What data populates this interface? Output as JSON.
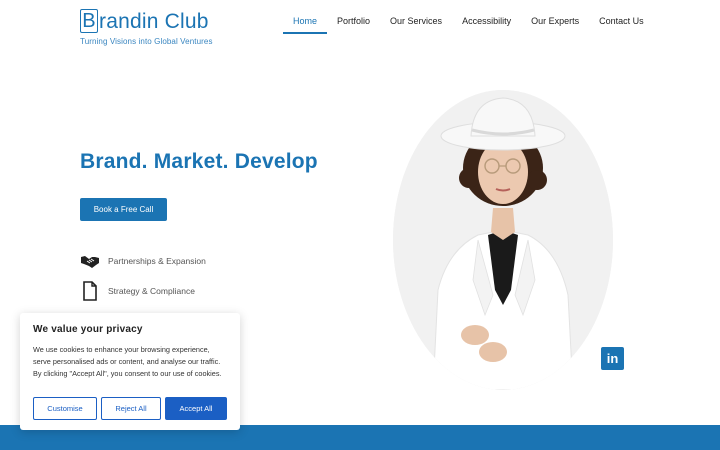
{
  "brand": {
    "name_initial": "B",
    "name_rest": "randin Club",
    "tagline": "Turning Visions into Global Ventures"
  },
  "nav": {
    "items": [
      {
        "label": "Home",
        "active": true
      },
      {
        "label": "Portfolio",
        "active": false
      },
      {
        "label": "Our Services",
        "active": false
      },
      {
        "label": "Accessibility",
        "active": false
      },
      {
        "label": "Our Experts",
        "active": false
      },
      {
        "label": "Contact Us",
        "active": false
      }
    ]
  },
  "hero": {
    "headline": "Brand. Market. Develop",
    "cta_label": "Book a Free Call",
    "features": [
      {
        "label": "Partnerships & Expansion",
        "icon": "handshake-icon"
      },
      {
        "label": "Strategy & Compliance",
        "icon": "document-icon"
      },
      {
        "label": "",
        "icon": "chart-icon"
      }
    ]
  },
  "social": {
    "linkedin_label": "in"
  },
  "cookie_banner": {
    "title": "We value your privacy",
    "body": "We use cookies to enhance your browsing experience, serve personalised ads or content, and analyse our traffic. By clicking \"Accept All\", you consent to our use of cookies.",
    "customise_label": "Customise",
    "reject_label": "Reject All",
    "accept_label": "Accept All"
  },
  "colors": {
    "brand_blue": "#1b74b3",
    "cookie_button_blue": "#1b5fc4"
  }
}
